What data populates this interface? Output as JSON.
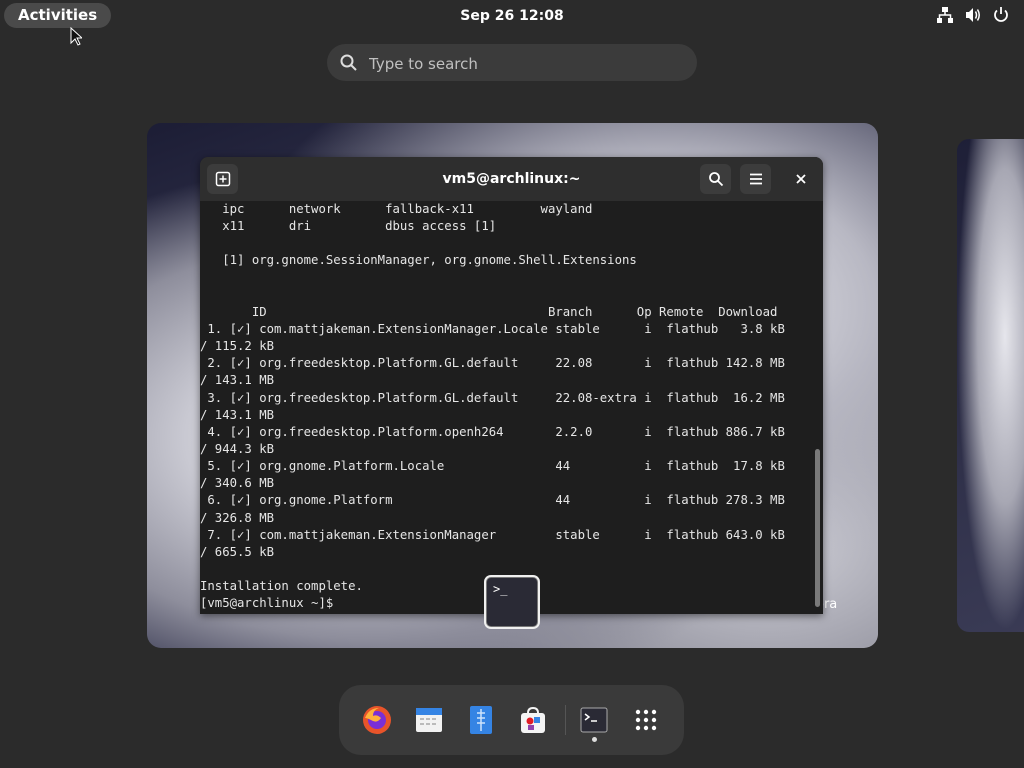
{
  "topbar": {
    "activities_label": "Activities",
    "clock": "Sep 26  12:08",
    "status_icons": [
      "network-icon",
      "volume-icon",
      "power-icon"
    ]
  },
  "search": {
    "placeholder": "Type to search"
  },
  "terminal": {
    "title": "vm5@archlinux:~",
    "lines": [
      "   ipc      network      fallback-x11         wayland",
      "   x11      dri          dbus access [1]",
      "",
      "   [1] org.gnome.SessionManager, org.gnome.Shell.Extensions",
      "",
      "",
      "       ID                                      Branch      Op Remote  Download",
      " 1. [✓] com.mattjakeman.ExtensionManager.Locale stable      i  flathub   3.8 kB",
      "/ 115.2 kB",
      " 2. [✓] org.freedesktop.Platform.GL.default     22.08       i  flathub 142.8 MB",
      "/ 143.1 MB",
      " 3. [✓] org.freedesktop.Platform.GL.default     22.08-extra i  flathub  16.2 MB",
      "/ 143.1 MB",
      " 4. [✓] org.freedesktop.Platform.openh264       2.2.0       i  flathub 886.7 kB",
      "/ 944.3 kB",
      " 5. [✓] org.gnome.Platform.Locale               44          i  flathub  17.8 kB",
      "/ 340.6 MB",
      " 6. [✓] org.gnome.Platform                      44          i  flathub 278.3 MB",
      "/ 326.8 MB",
      " 7. [✓] com.mattjakeman.ExtensionManager        stable      i  flathub 643.0 kB",
      "/ 665.5 kB",
      "",
      "Installation complete.",
      "[vm5@archlinux ~]$ "
    ]
  },
  "terminal_overlay_icon": ">_",
  "wallpaper_text": "ora",
  "dash": {
    "apps": [
      "firefox-icon",
      "calendar-icon",
      "text-editor-icon",
      "software-icon",
      "terminal-icon",
      "app-grid-icon"
    ]
  },
  "colors": {
    "check": "#7fbf6a",
    "panel": "#2b2b2b",
    "terminal_bg": "#1e1e1e"
  }
}
